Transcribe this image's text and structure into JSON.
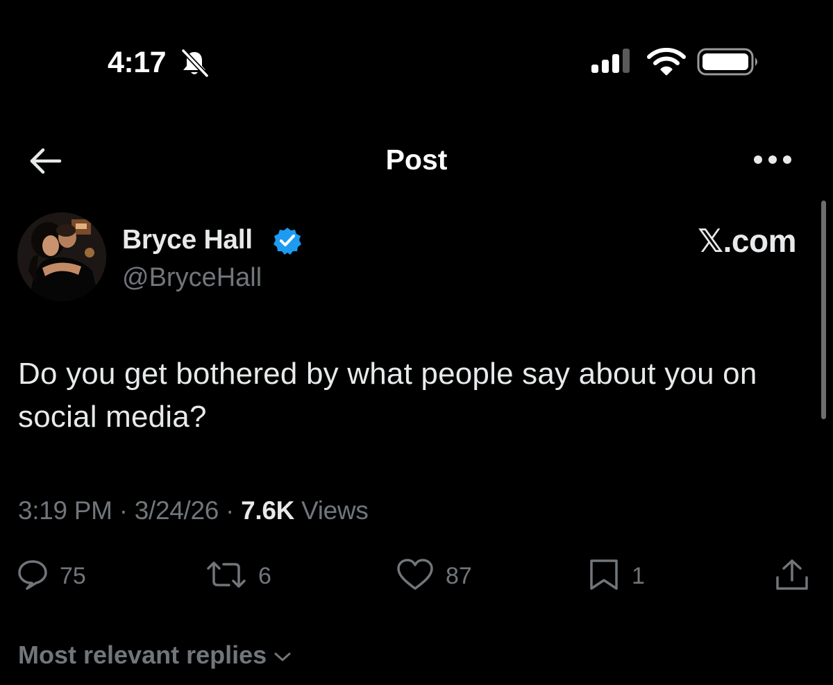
{
  "status_bar": {
    "time": "4:17",
    "icons": [
      "bell-slash-icon",
      "cellular-signal-icon",
      "wifi-icon",
      "battery-icon"
    ]
  },
  "nav": {
    "title": "Post",
    "back_icon": "back-arrow-icon",
    "more_icon": "more-horizontal-icon"
  },
  "post": {
    "author_name": "Bryce Hall",
    "verified": true,
    "handle": "@BryceHall",
    "watermark": "𝕏.com",
    "text": "Do you get bothered by what people say about you on social media?",
    "time": "3:19 PM",
    "date": "3/24/26",
    "separator": "·",
    "views_count": "7.6K",
    "views_label": "Views"
  },
  "actions": {
    "replies": "75",
    "reposts": "6",
    "likes": "87",
    "bookmarks": "1"
  },
  "replies_sort": {
    "label": "Most relevant replies"
  },
  "colors": {
    "background": "#000000",
    "primary_text": "#e7e9ea",
    "secondary_text": "#71767b",
    "verified_blue": "#1d9bf0"
  }
}
